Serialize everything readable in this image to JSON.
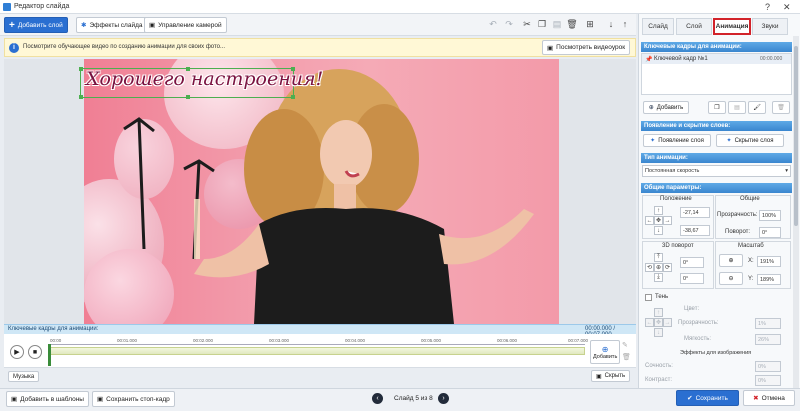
{
  "window": {
    "title": "Редактор слайда"
  },
  "toolbar": {
    "add_layer": "Добавить слой",
    "slide_effects": "Эффекты слайда",
    "camera": "Управление камерой"
  },
  "hint": {
    "text": "Посмотрите обучающее видео по созданию анимации для своих фото...",
    "watch": "Посмотреть видеоурок"
  },
  "canvas": {
    "caption": "Хорошего настроения!"
  },
  "timeline": {
    "header": "Ключевые кадры для анимации:",
    "time": "00:00.000 / 00:07.000",
    "ticks": [
      "00:00",
      "00:01.000",
      "00:02.000",
      "00:03.000",
      "00:04.000",
      "00:05.000",
      "00:06.000",
      "00:07.000"
    ],
    "add": "Добавить",
    "hide": "Скрыть",
    "music": "Музыка"
  },
  "tabs": [
    {
      "label": "Слайд"
    },
    {
      "label": "Слой"
    },
    {
      "label": "Анимация"
    },
    {
      "label": "Звуки"
    }
  ],
  "panel": {
    "keyframes_title": "Ключевые кадры для анимации:",
    "keyframe_name": "Ключевой кадр №1",
    "keyframe_time": "00:00.000",
    "add_btn": "Добавить",
    "appear_title": "Появление и скрытие слоев:",
    "appear_btn": "Появление слоя",
    "hide_btn": "Скрытие слоя",
    "anim_type_title": "Тип анимации:",
    "anim_type_value": "Постоянная скорость",
    "params_title": "Общие параметры:",
    "pos_label": "Положение",
    "pos_x": "-27,14",
    "pos_y": "-38,67",
    "common_label": "Общие",
    "opacity_label": "Прозрачность:",
    "opacity_value": "100%",
    "rotate_label": "Поворот:",
    "rotate_value": "0°",
    "rot3d_label": "3D поворот",
    "rot3d_a": "0°",
    "rot3d_b": "0°",
    "scale_label": "Масштаб",
    "scale_x_label": "X:",
    "scale_x": "191%",
    "scale_y_label": "Y:",
    "scale_y": "189%",
    "shadow_label": "Тень",
    "color_label": "Цвет:",
    "shadow_opacity_label": "Прозрачность:",
    "shadow_opacity": "1%",
    "softness_label": "Мягкость:",
    "softness": "26%",
    "img_effects_title": "Эффекты для изображения",
    "saturation_label": "Сочность:",
    "saturation": "0%",
    "contrast_label": "Контраст:",
    "contrast": "0%"
  },
  "status": {
    "add_template": "Добавить в шаблоны",
    "save_frame": "Сохранить стоп-кадр",
    "slide_info": "Слайд 5 из 8",
    "save": "Сохранить",
    "cancel": "Отмена"
  }
}
